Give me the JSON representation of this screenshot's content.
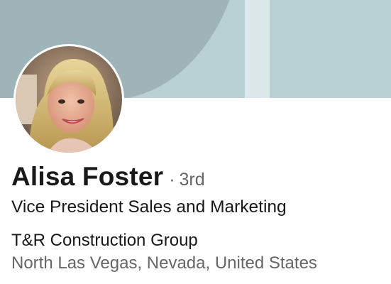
{
  "profile": {
    "name": "Alisa Foster",
    "degree_separator": "·",
    "degree": "3rd",
    "headline": "Vice President Sales and Marketing",
    "company": "T&R Construction Group",
    "location": "North Las Vegas, Nevada, United States"
  },
  "colors": {
    "banner_light": "#b9d0d5",
    "banner_dark": "#9fb4b8",
    "text_primary": "#191919",
    "text_secondary": "#666666"
  }
}
